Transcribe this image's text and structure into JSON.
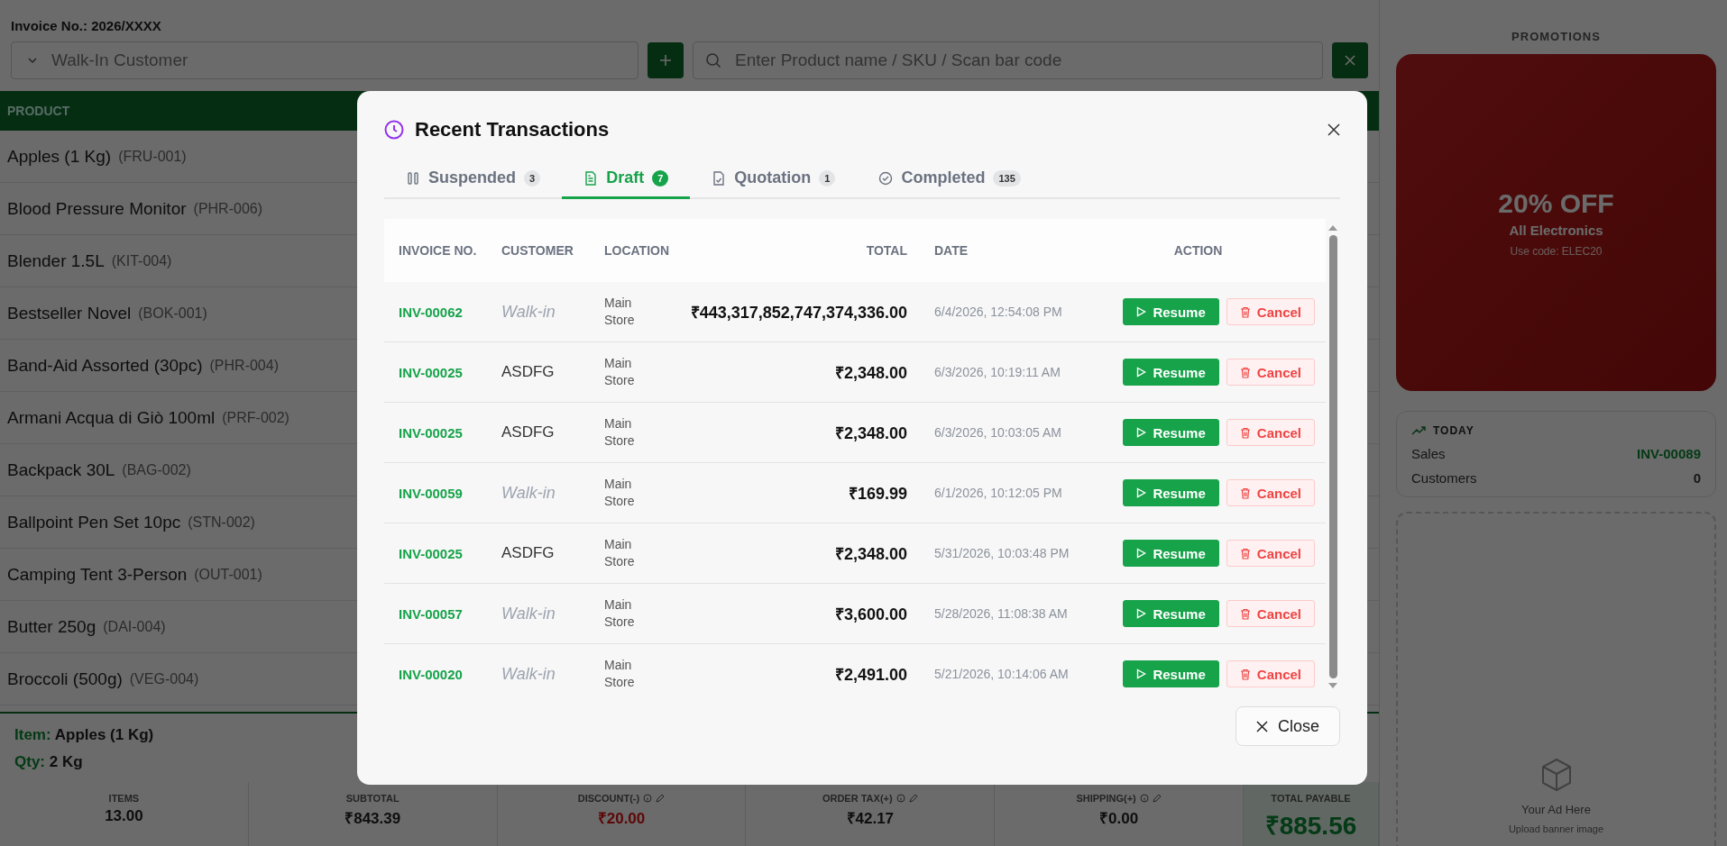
{
  "invoice": {
    "label": "Invoice No.:",
    "number": "2026/XXXX"
  },
  "customer_select": {
    "value": "Walk-In Customer"
  },
  "product_search": {
    "placeholder": "Enter Product name / SKU / Scan bar code"
  },
  "product_table": {
    "column_1": "PRODUCT",
    "rows": [
      {
        "name": "Apples (1 Kg)",
        "sku": "(FRU-001)"
      },
      {
        "name": "Blood Pressure Monitor",
        "sku": "(PHR-006)"
      },
      {
        "name": "Blender 1.5L",
        "sku": "(KIT-004)"
      },
      {
        "name": "Bestseller Novel",
        "sku": "(BOK-001)"
      },
      {
        "name": "Band-Aid Assorted (30pc)",
        "sku": "(PHR-004)"
      },
      {
        "name": "Armani Acqua di Giò 100ml",
        "sku": "(PRF-002)"
      },
      {
        "name": "Backpack 30L",
        "sku": "(BAG-002)"
      },
      {
        "name": "Ballpoint Pen Set 10pc",
        "sku": "(STN-002)"
      },
      {
        "name": "Camping Tent 3-Person",
        "sku": "(OUT-001)"
      },
      {
        "name": "Butter 250g",
        "sku": "(DAI-004)"
      },
      {
        "name": "Broccoli (500g)",
        "sku": "(VEG-004)"
      }
    ]
  },
  "selected_item": {
    "item_label": "Item:",
    "item": "Apples (1 Kg)",
    "qty_label": "Qty:",
    "qty": "2 Kg"
  },
  "summary": [
    {
      "label": "ITEMS",
      "value": "13.00",
      "kind": "plain",
      "editable": false
    },
    {
      "label": "SUBTOTAL",
      "value": "₹843.39",
      "kind": "plain",
      "editable": false
    },
    {
      "label": "DISCOUNT(-)",
      "value": "₹20.00",
      "kind": "negative",
      "editable": true
    },
    {
      "label": "ORDER TAX(+)",
      "value": "₹42.17",
      "kind": "plain",
      "editable": true
    },
    {
      "label": "SHIPPING(+)",
      "value": "₹0.00",
      "kind": "plain",
      "editable": true
    },
    {
      "label": "TOTAL PAYABLE",
      "value": "₹885.56",
      "kind": "total",
      "editable": false
    }
  ],
  "promotions": {
    "title": "PROMOTIONS",
    "card": {
      "headline": "20% OFF",
      "subtitle": "All Electronics",
      "code_text": "Use code: ELEC20"
    }
  },
  "today": {
    "title": "TODAY",
    "rows": [
      {
        "label": "Sales",
        "value": "INV-00089",
        "kind": "link"
      },
      {
        "label": "Customers",
        "value": "0",
        "kind": "plain"
      }
    ]
  },
  "ad": {
    "title": "Your Ad Here",
    "subtitle": "Upload banner image"
  },
  "modal": {
    "title": "Recent Transactions",
    "close_label": "Close",
    "tabs": [
      {
        "label": "Suspended",
        "count": "3",
        "selected": false
      },
      {
        "label": "Draft",
        "count": "7",
        "selected": true
      },
      {
        "label": "Quotation",
        "count": "1",
        "selected": false
      },
      {
        "label": "Completed",
        "count": "135",
        "selected": false
      }
    ],
    "columns": [
      "INVOICE NO.",
      "CUSTOMER",
      "LOCATION",
      "TOTAL",
      "DATE",
      "ACTION"
    ],
    "rows": [
      {
        "invoice": "INV-00062",
        "customer": "Walk-in",
        "kind": "guest",
        "location": "Main Store",
        "total": "₹443,317,852,747,374,336.00",
        "date": "6/4/2026, 12:54:08 PM",
        "resume": "Resume",
        "cancel": "Cancel"
      },
      {
        "invoice": "INV-00025",
        "customer": "ASDFG",
        "kind": "named",
        "location": "Main Store",
        "total": "₹2,348.00",
        "date": "6/3/2026, 10:19:11 AM",
        "resume": "Resume",
        "cancel": "Cancel"
      },
      {
        "invoice": "INV-00025",
        "customer": "ASDFG",
        "kind": "named",
        "location": "Main Store",
        "total": "₹2,348.00",
        "date": "6/3/2026, 10:03:05 AM",
        "resume": "Resume",
        "cancel": "Cancel"
      },
      {
        "invoice": "INV-00059",
        "customer": "Walk-in",
        "kind": "guest",
        "location": "Main Store",
        "total": "₹169.99",
        "date": "6/1/2026, 10:12:05 PM",
        "resume": "Resume",
        "cancel": "Cancel"
      },
      {
        "invoice": "INV-00025",
        "customer": "ASDFG",
        "kind": "named",
        "location": "Main Store",
        "total": "₹2,348.00",
        "date": "5/31/2026, 10:03:48 PM",
        "resume": "Resume",
        "cancel": "Cancel"
      },
      {
        "invoice": "INV-00057",
        "customer": "Walk-in",
        "kind": "guest",
        "location": "Main Store",
        "total": "₹3,600.00",
        "date": "5/28/2026, 11:08:38 AM",
        "resume": "Resume",
        "cancel": "Cancel"
      },
      {
        "invoice": "INV-00020",
        "customer": "Walk-in",
        "kind": "guest",
        "location": "Main Store",
        "total": "₹2,491.00",
        "date": "5/21/2026, 10:14:06 AM",
        "resume": "Resume",
        "cancel": "Cancel"
      }
    ]
  }
}
